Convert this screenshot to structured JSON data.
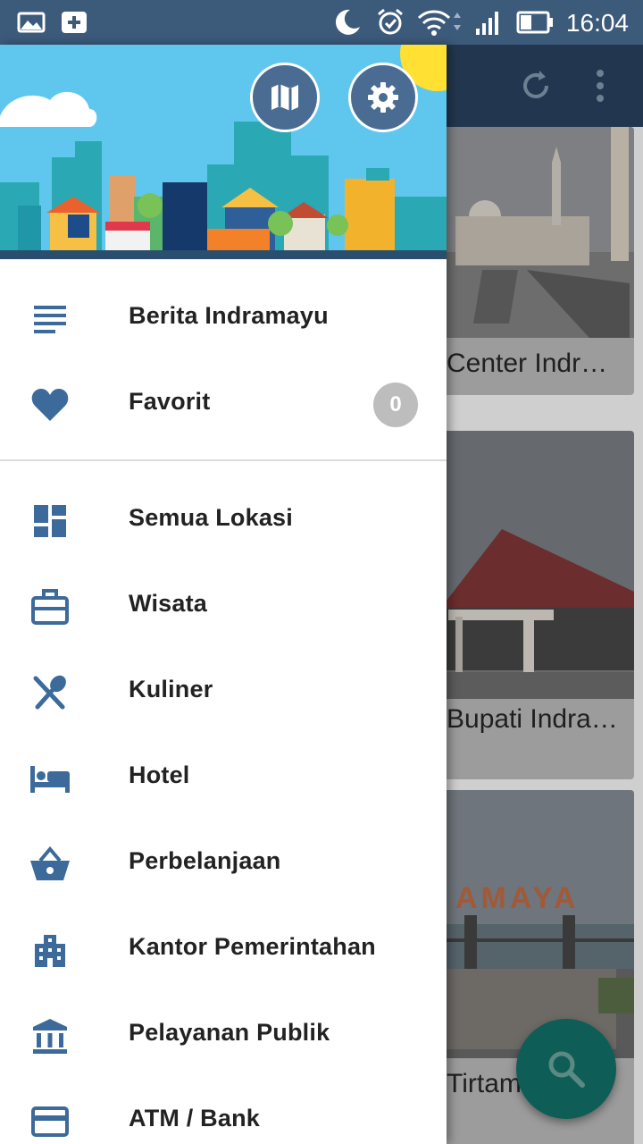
{
  "status_bar": {
    "time": "16:04"
  },
  "colors": {
    "accent": "#3c6a9a",
    "status_bar": "#3c5a7a",
    "fab": "#0e5e57",
    "badge": "#bdbdbd",
    "header_sky": "#5fc7ee"
  },
  "background": {
    "cards": [
      {
        "title": "Center Indr…"
      },
      {
        "title": "Bupati Indra…"
      },
      {
        "title": "Tirtama"
      }
    ],
    "sign_text": "AMAYA"
  },
  "drawer": {
    "header_buttons": [
      {
        "icon": "map-icon"
      },
      {
        "icon": "gear-icon"
      }
    ],
    "top_items": [
      {
        "label": "Berita Indramayu",
        "icon": "news-icon"
      },
      {
        "label": "Favorit",
        "icon": "heart-icon",
        "badge": "0"
      }
    ],
    "categories": [
      {
        "label": "Semua Lokasi",
        "icon": "dashboard-icon"
      },
      {
        "label": "Wisata",
        "icon": "briefcase-icon"
      },
      {
        "label": "Kuliner",
        "icon": "utensils-icon"
      },
      {
        "label": "Hotel",
        "icon": "bed-icon"
      },
      {
        "label": "Perbelanjaan",
        "icon": "basket-icon"
      },
      {
        "label": "Kantor Pemerintahan",
        "icon": "building-icon"
      },
      {
        "label": "Pelayanan Publik",
        "icon": "bank-icon"
      },
      {
        "label": "ATM / Bank",
        "icon": "credit-card-icon"
      }
    ]
  }
}
